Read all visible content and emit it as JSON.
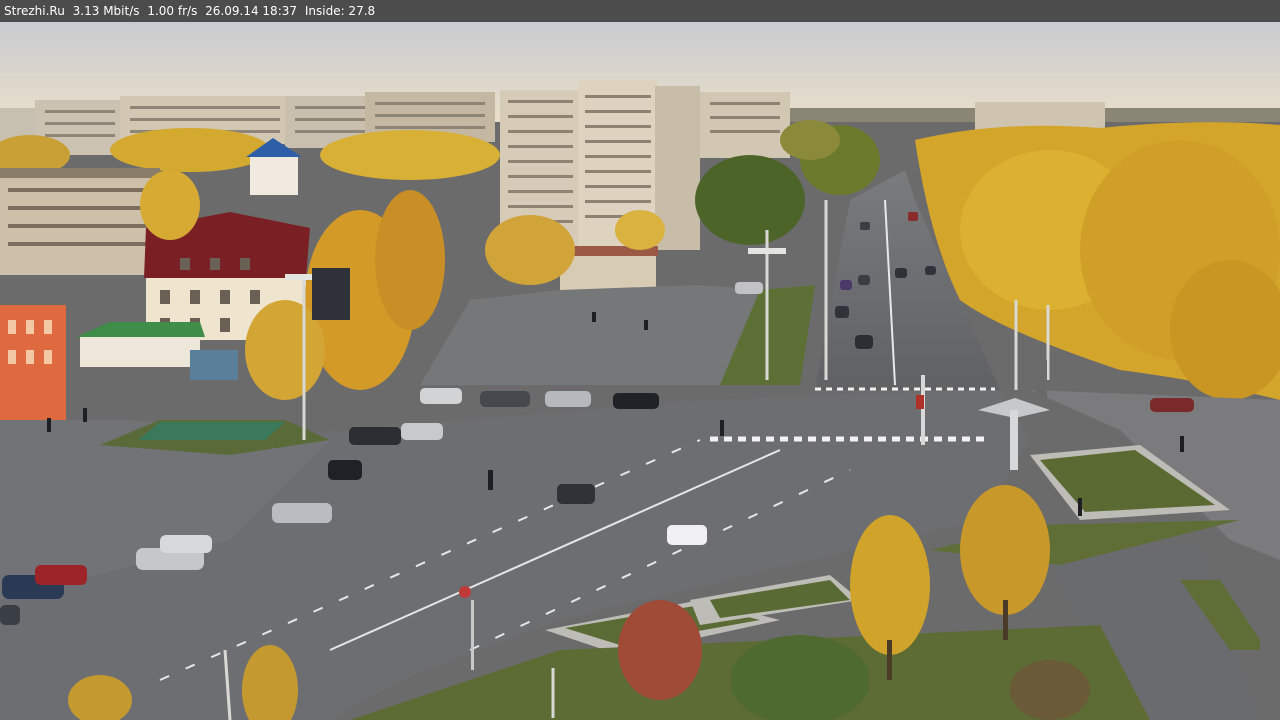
{
  "overlay": {
    "site": "Strezhi.Ru",
    "bitrate": "3.13 Mbit/s",
    "framerate": "1.00 fr/s",
    "datetime": "26.09.14 18:37",
    "inside_label": "Inside: 27.8"
  },
  "colors": {
    "sky_top": "#c9ccd0",
    "sky_horizon": "#e8ddc8",
    "asphalt": "#6e6f72",
    "foliage_yellow": "#d9a62a",
    "foliage_green": "#4f6b2a",
    "building_beige": "#cfc3ae",
    "roof_red": "#7a1f1f",
    "lawn": "#5d6d3a"
  },
  "scene": {
    "icons": [
      "streetlamp-icon",
      "car-icon",
      "pedestrian-icon",
      "traffic-light-icon",
      "tree-icon",
      "building-icon"
    ]
  }
}
